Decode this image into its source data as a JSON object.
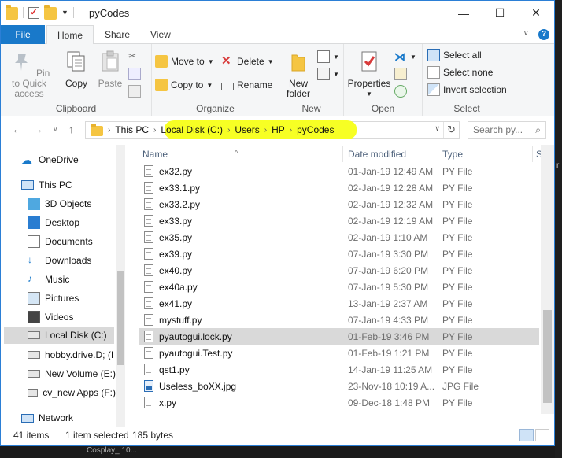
{
  "window": {
    "title": "pyCodes"
  },
  "window_controls": {
    "minimize": "—",
    "maximize": "☐",
    "close": "✕"
  },
  "tabs": {
    "file": "File",
    "home": "Home",
    "share": "Share",
    "view": "View"
  },
  "ribbon": {
    "clipboard": {
      "group": "Clipboard",
      "pin": "Pin to Quick access",
      "copy": "Copy",
      "paste": "Paste"
    },
    "organize": {
      "group": "Organize",
      "move_to": "Move to",
      "copy_to": "Copy to",
      "delete": "Delete",
      "rename": "Rename"
    },
    "new": {
      "group": "New",
      "new_folder": "New folder"
    },
    "open": {
      "group": "Open",
      "properties": "Properties"
    },
    "select": {
      "group": "Select",
      "select_all": "Select all",
      "select_none": "Select none",
      "invert_selection": "Invert selection"
    }
  },
  "address": {
    "crumbs": [
      "This PC",
      "Local Disk (C:)",
      "Users",
      "HP",
      "pyCodes"
    ],
    "highlight_color": "#f7ff24"
  },
  "search": {
    "placeholder": "Search py..."
  },
  "nav": {
    "items": [
      {
        "label": "OneDrive",
        "icon": "cloud-icon"
      },
      {
        "label": "This PC",
        "icon": "computer-icon"
      },
      {
        "label": "3D Objects",
        "icon": "cube-icon"
      },
      {
        "label": "Desktop",
        "icon": "desktop-icon"
      },
      {
        "label": "Documents",
        "icon": "documents-icon"
      },
      {
        "label": "Downloads",
        "icon": "download-icon"
      },
      {
        "label": "Music",
        "icon": "music-icon"
      },
      {
        "label": "Pictures",
        "icon": "pictures-icon"
      },
      {
        "label": "Videos",
        "icon": "videos-icon"
      },
      {
        "label": "Local Disk (C:)",
        "icon": "drive-icon"
      },
      {
        "label": "hobby.drive.D; (I",
        "icon": "drive-icon"
      },
      {
        "label": "New Volume (E:)",
        "icon": "drive-icon"
      },
      {
        "label": "cv_new Apps (F:)",
        "icon": "drive-icon"
      },
      {
        "label": "Network",
        "icon": "network-icon"
      }
    ]
  },
  "columns": {
    "name": "Name",
    "date": "Date modified",
    "type": "Type",
    "size": "S"
  },
  "files": [
    {
      "name": "ex32.py",
      "date": "01-Jan-19 12:49 AM",
      "type": "PY File"
    },
    {
      "name": "ex33.1.py",
      "date": "02-Jan-19 12:28 AM",
      "type": "PY File"
    },
    {
      "name": "ex33.2.py",
      "date": "02-Jan-19 12:32 AM",
      "type": "PY File"
    },
    {
      "name": "ex33.py",
      "date": "02-Jan-19 12:19 AM",
      "type": "PY File"
    },
    {
      "name": "ex35.py",
      "date": "02-Jan-19 1:10 AM",
      "type": "PY File"
    },
    {
      "name": "ex39.py",
      "date": "07-Jan-19 3:30 PM",
      "type": "PY File"
    },
    {
      "name": "ex40.py",
      "date": "07-Jan-19 6:20 PM",
      "type": "PY File"
    },
    {
      "name": "ex40a.py",
      "date": "07-Jan-19 5:30 PM",
      "type": "PY File"
    },
    {
      "name": "ex41.py",
      "date": "13-Jan-19 2:37 AM",
      "type": "PY File"
    },
    {
      "name": "mystuff.py",
      "date": "07-Jan-19 4:33 PM",
      "type": "PY File"
    },
    {
      "name": "pyautogui.lock.py",
      "date": "01-Feb-19 3:46 PM",
      "type": "PY File"
    },
    {
      "name": "pyautogui.Test.py",
      "date": "01-Feb-19 1:21 PM",
      "type": "PY File"
    },
    {
      "name": "qst1.py",
      "date": "14-Jan-19 11:25 AM",
      "type": "PY File"
    },
    {
      "name": "Useless_boXX.jpg",
      "date": "23-Nov-18 10:19 A...",
      "type": "JPG File"
    },
    {
      "name": "x.py",
      "date": "09-Dec-18 1:48 PM",
      "type": "PY File"
    }
  ],
  "status": {
    "items": "41 items",
    "selected": "1 item selected",
    "size": "185 bytes"
  },
  "background": {
    "taskbar_text": "Cosplay_ 10...",
    "strip_text": "ri"
  }
}
